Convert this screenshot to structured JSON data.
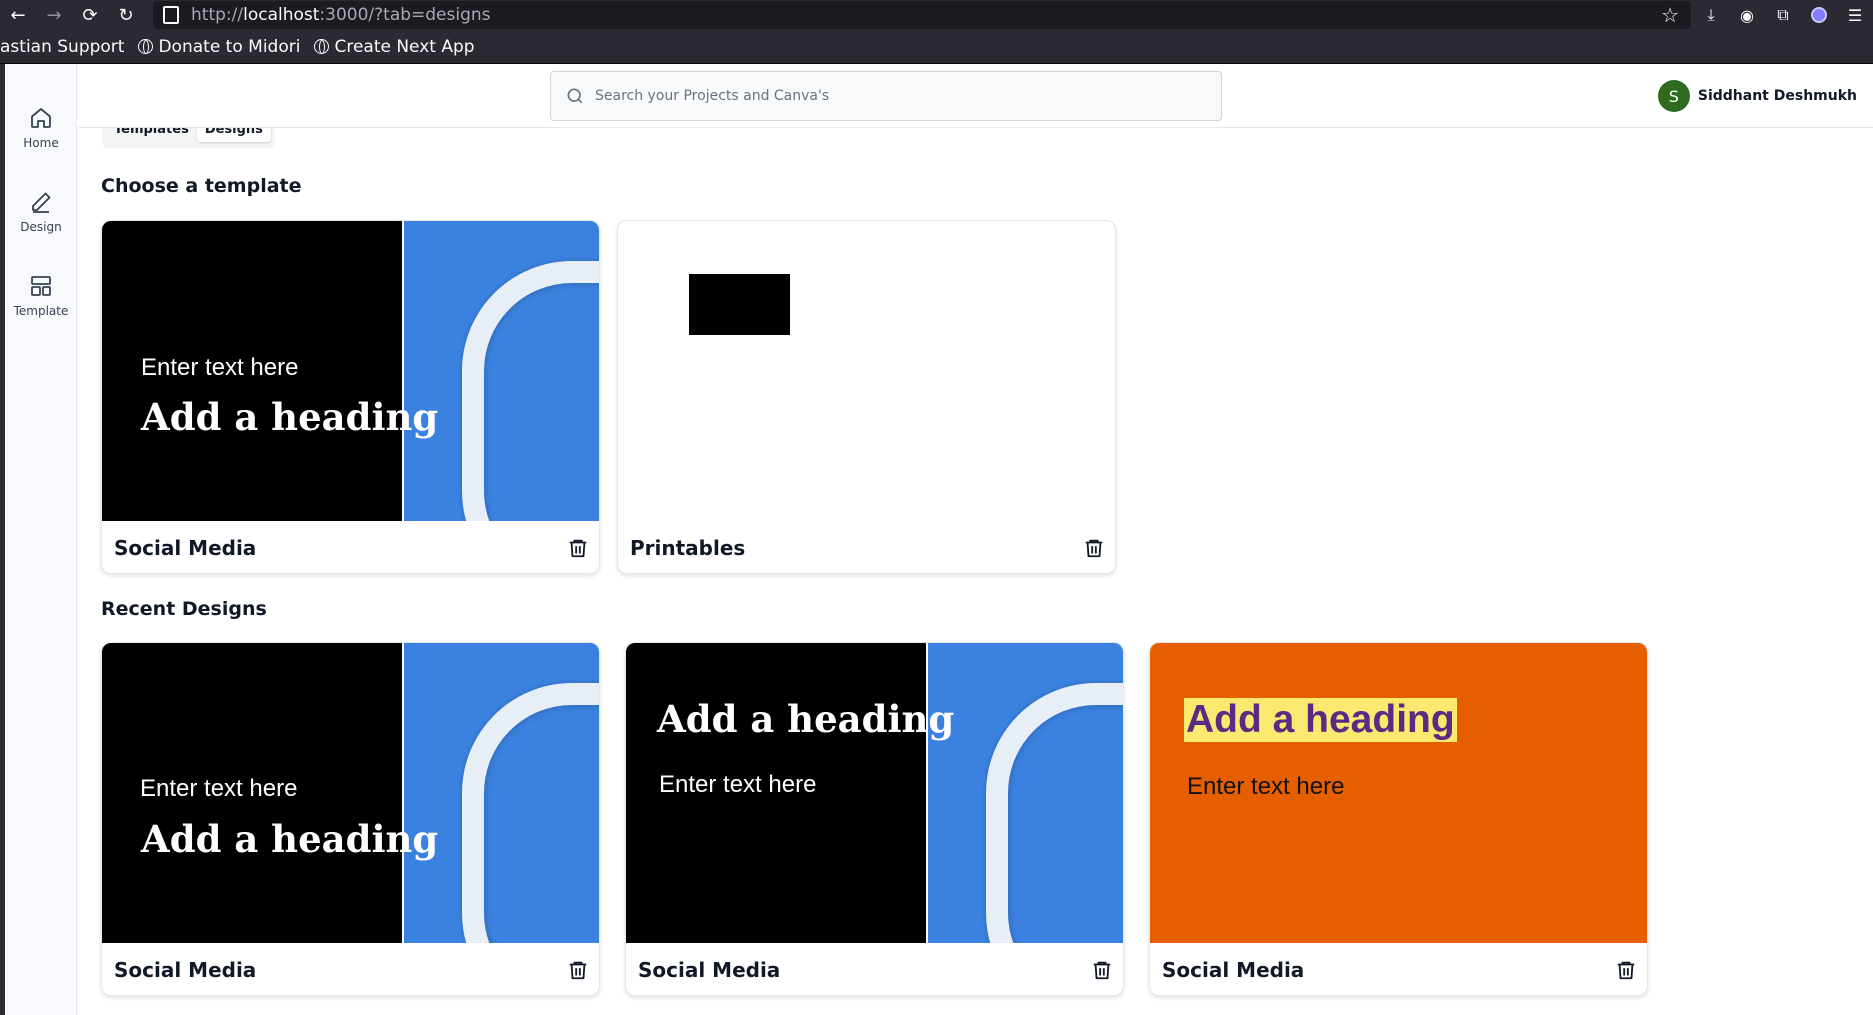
{
  "browser": {
    "url_prefix": "http://",
    "url_host": "localhost",
    "url_rest": ":3000/?tab=designs",
    "bookmarks": [
      "astian Support",
      "Donate to Midori",
      "Create Next App"
    ]
  },
  "sidebar": {
    "items": [
      {
        "label": "Home",
        "icon": "home-icon"
      },
      {
        "label": "Design",
        "icon": "pencil-icon"
      },
      {
        "label": "Template",
        "icon": "template-icon"
      }
    ]
  },
  "header": {
    "search_placeholder": "Search your Projects and Canva's",
    "user_initial": "S",
    "user_name": "Siddhant Deshmukh",
    "avatar_color": "#2e6b1e"
  },
  "tabs": [
    "Templates",
    "Designs"
  ],
  "templates_section": {
    "title": "Choose a template",
    "cards": [
      {
        "title": "Social Media",
        "text": "Enter text here",
        "heading": "Add a heading"
      },
      {
        "title": "Printables"
      }
    ]
  },
  "recent_section": {
    "title": "Recent Designs",
    "cards": [
      {
        "title": "Social Media",
        "text": "Enter text here",
        "heading": "Add a heading"
      },
      {
        "title": "Social Media",
        "text": "Enter text here",
        "heading": "Add a heading"
      },
      {
        "title": "Social Media",
        "text": "Enter text here",
        "heading": "Add a heading"
      }
    ]
  },
  "colors": {
    "orange_bg": "#e55e00",
    "highlight": "#f9e96f",
    "heading_purple": "#5b2a82",
    "photo_blue": "#3b82e0"
  }
}
